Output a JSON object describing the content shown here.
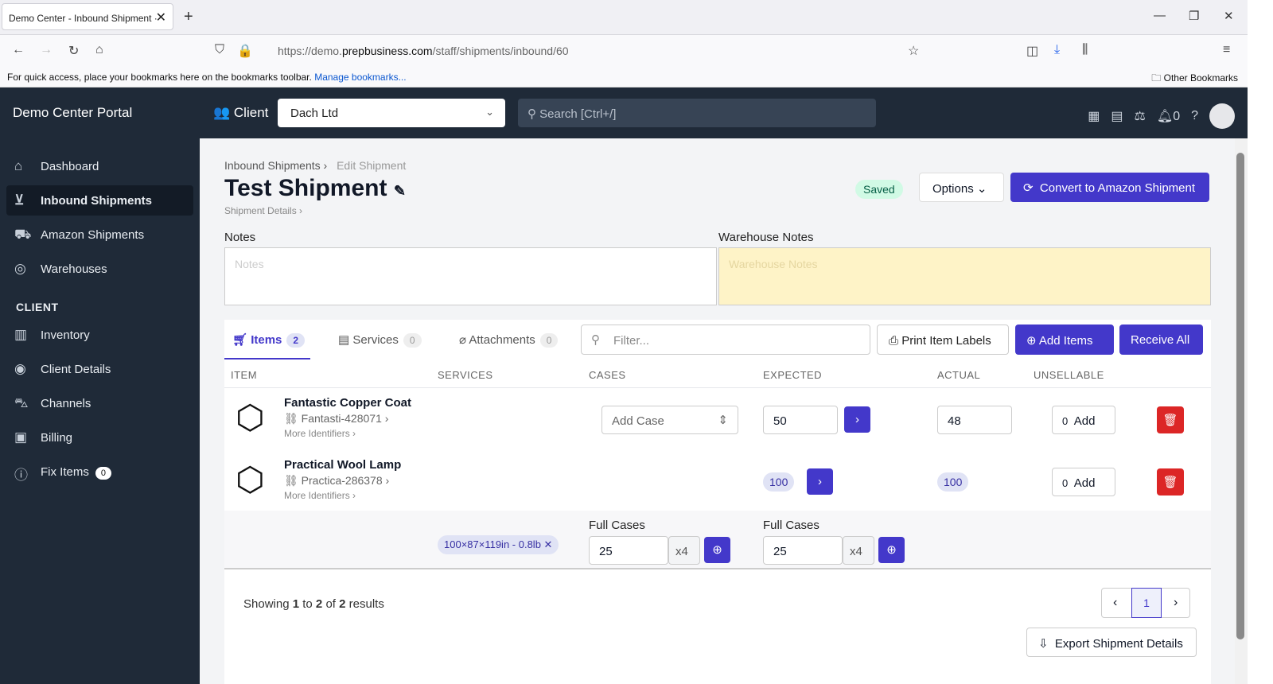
{
  "browser": {
    "tab_title": "Demo Center - Inbound Shipment ·",
    "url_prefix": "https://demo.",
    "url_host": "prepbusiness.com",
    "url_path": "/staff/shipments/inbound/60",
    "bookmarks_hint": "For quick access, place your bookmarks here on the bookmarks toolbar.",
    "manage_bookmarks": "Manage bookmarks...",
    "other_bookmarks": "Other Bookmarks"
  },
  "header": {
    "brand": "Demo Center Portal",
    "client_label": "Client",
    "client_value": "Dach Ltd",
    "search_placeholder": "Search [Ctrl+/]",
    "notif_count": "0"
  },
  "sidebar": {
    "items": [
      {
        "label": "Dashboard",
        "icon": "home-icon"
      },
      {
        "label": "Inbound Shipments",
        "icon": "inbox-icon"
      },
      {
        "label": "Amazon Shipments",
        "icon": "truck-icon"
      },
      {
        "label": "Warehouses",
        "icon": "location-icon"
      }
    ],
    "section": "CLIENT",
    "client_items": [
      {
        "label": "Inventory",
        "icon": "warehouse-icon"
      },
      {
        "label": "Client Details",
        "icon": "user-icon"
      },
      {
        "label": "Channels",
        "icon": "cart-icon"
      },
      {
        "label": "Billing",
        "icon": "billing-icon"
      },
      {
        "label": "Fix Items",
        "icon": "alert-icon",
        "badge": "0"
      }
    ]
  },
  "page": {
    "breadcrumb_parent": "Inbound Shipments",
    "breadcrumb_current": "Edit Shipment",
    "title": "Test Shipment",
    "subtitle": "Shipment Details",
    "status": "Saved",
    "options_label": "Options",
    "convert_label": "Convert to Amazon Shipment",
    "notes_label": "Notes",
    "notes_placeholder": "Notes",
    "warehouse_notes_label": "Warehouse Notes",
    "warehouse_notes_placeholder": "Warehouse Notes"
  },
  "tabs": [
    {
      "label": "Items",
      "count": "2"
    },
    {
      "label": "Services",
      "count": "0"
    },
    {
      "label": "Attachments",
      "count": "0"
    }
  ],
  "toolbar": {
    "filter_placeholder": "Filter...",
    "print_labels": "Print Item Labels",
    "add_items": "Add Items",
    "receive_all": "Receive All"
  },
  "table": {
    "headers": [
      "ITEM",
      "SERVICES",
      "CASES",
      "EXPECTED",
      "ACTUAL",
      "UNSELLABLE"
    ],
    "rows": [
      {
        "name": "Fantastic Copper Coat",
        "sku": "Fantasti-428071",
        "more": "More Identifiers",
        "cases": "Add Case",
        "expected": "50",
        "actual": "48",
        "unsellable": "0",
        "add": "Add"
      },
      {
        "name": "Practical Wool Lamp",
        "sku": "Practica-286378",
        "more": "More Identifiers",
        "expected": "100",
        "actual": "100",
        "unsellable": "0",
        "add": "Add"
      }
    ]
  },
  "case_row": {
    "dimensions": "100×87×119in - 0.8lb",
    "full_cases_label": "Full Cases",
    "expected_cases": "25",
    "actual_cases": "25",
    "multiplier": "x4"
  },
  "footer": {
    "showing": "Showing",
    "from": "1",
    "to_word": "to",
    "to": "2",
    "of_word": "of",
    "total": "2",
    "results_word": "results",
    "current_page": "1",
    "export_label": "Export Shipment Details"
  }
}
